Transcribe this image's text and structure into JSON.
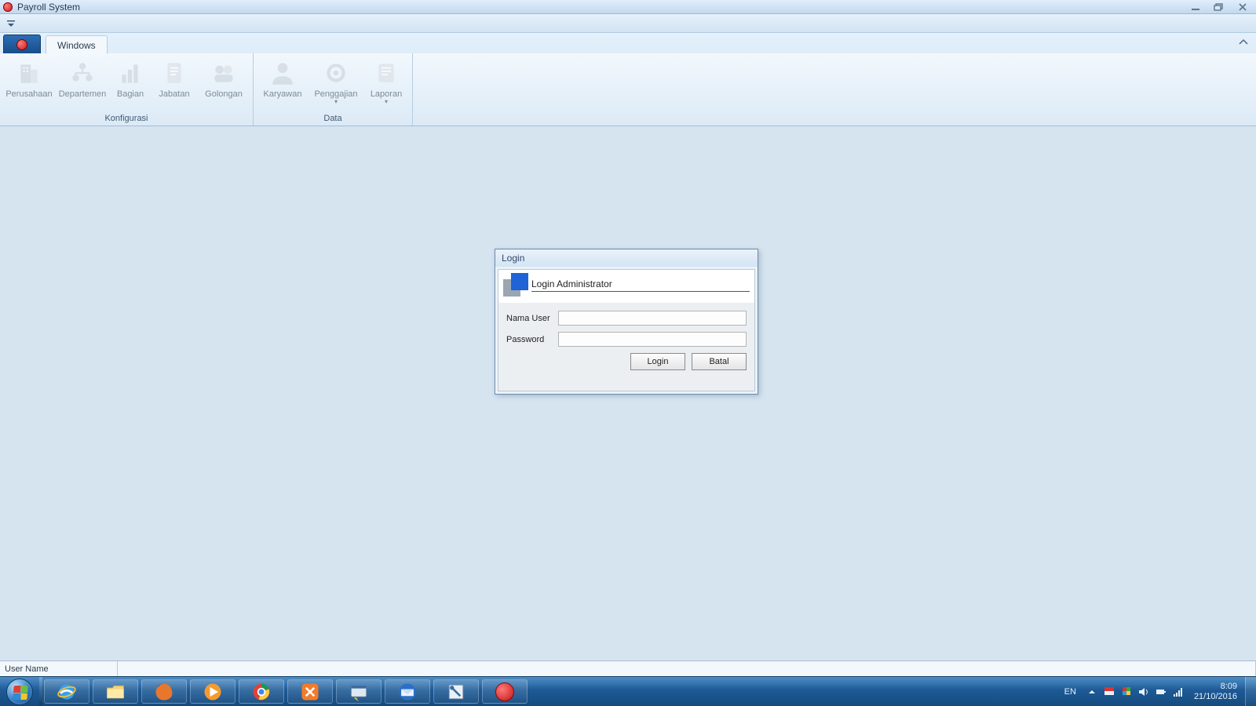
{
  "window": {
    "title": "Payroll System"
  },
  "ribbon": {
    "tab_windows": "Windows",
    "groups": {
      "konfigurasi": {
        "label": "Konfigurasi",
        "perusahaan": "Perusahaan",
        "departemen": "Departemen",
        "bagian": "Bagian",
        "jabatan": "Jabatan",
        "golongan": "Golongan"
      },
      "data": {
        "label": "Data",
        "karyawan": "Karyawan",
        "penggajian": "Penggajian",
        "laporan": "Laporan"
      }
    }
  },
  "login": {
    "title": "Login",
    "header": "Login Administrator",
    "label_user": "Nama User",
    "label_pass": "Password",
    "value_user": "",
    "value_pass": "",
    "btn_login": "Login",
    "btn_batal": "Batal"
  },
  "status": {
    "username_label": "User Name"
  },
  "tray": {
    "lang": "EN",
    "time": "8:09",
    "date": "21/10/2016"
  }
}
